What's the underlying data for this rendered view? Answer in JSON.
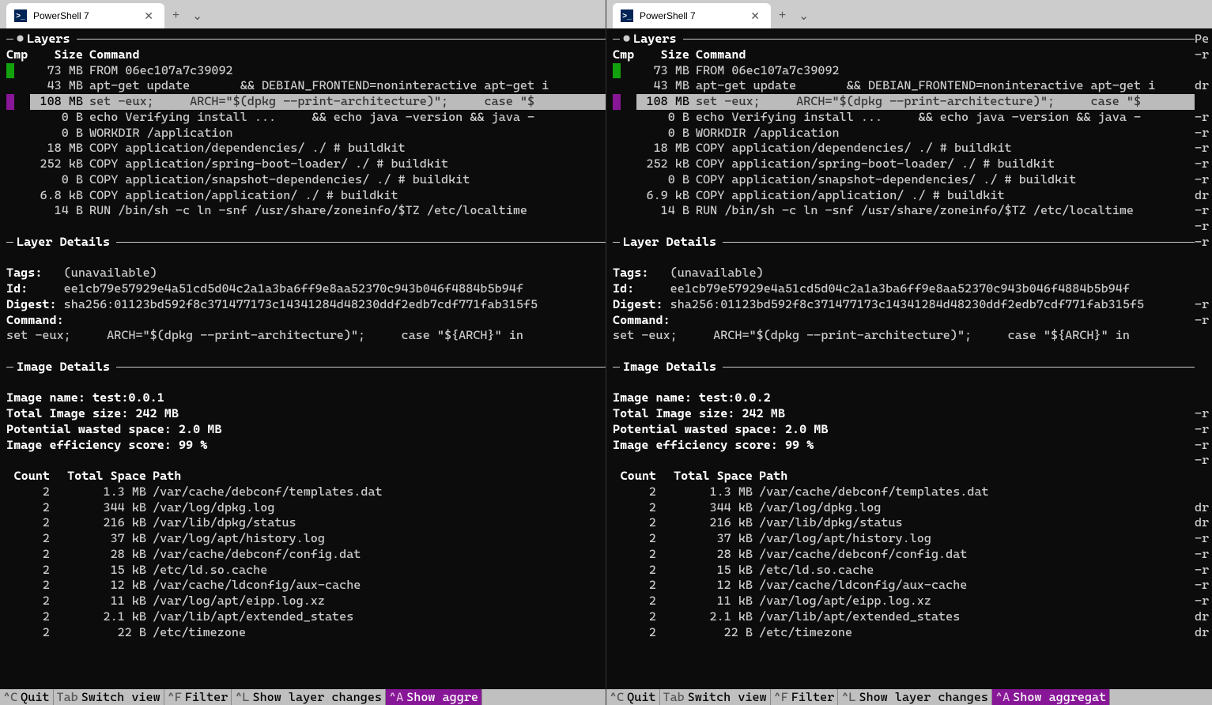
{
  "panes": [
    {
      "tab_title": "PowerShell 7",
      "layers_title": "Layers",
      "layers_header": {
        "cmp": "Cmp",
        "size": "Size",
        "command": "Command"
      },
      "layers": [
        {
          "cmp": "green",
          "size": "73 MB",
          "command": "FROM 06ec107a7c39092",
          "selected": false
        },
        {
          "cmp": "",
          "size": "43 MB",
          "command": "apt-get update       && DEBIAN_FRONTEND=noninteractive apt-get i",
          "selected": false
        },
        {
          "cmp": "purple",
          "size": "108 MB",
          "command": "set -eux;     ARCH=\"$(dpkg --print-architecture)\";     case \"$",
          "selected": true
        },
        {
          "cmp": "",
          "size": "0 B",
          "command": "echo Verifying install ...     && echo java -version && java -",
          "selected": false
        },
        {
          "cmp": "",
          "size": "0 B",
          "command": "WORKDIR /application",
          "selected": false
        },
        {
          "cmp": "",
          "size": "18 MB",
          "command": "COPY application/dependencies/ ./ # buildkit",
          "selected": false
        },
        {
          "cmp": "",
          "size": "252 kB",
          "command": "COPY application/spring-boot-loader/ ./ # buildkit",
          "selected": false
        },
        {
          "cmp": "",
          "size": "0 B",
          "command": "COPY application/snapshot-dependencies/ ./ # buildkit",
          "selected": false
        },
        {
          "cmp": "",
          "size": "6.8 kB",
          "command": "COPY application/application/ ./ # buildkit",
          "selected": false
        },
        {
          "cmp": "",
          "size": "14 B",
          "command": "RUN /bin/sh -c ln -snf /usr/share/zoneinfo/$TZ /etc/localtime",
          "selected": false
        }
      ],
      "layer_details_title": "Layer Details",
      "layer_details": {
        "tags_label": "Tags:",
        "tags": "(unavailable)",
        "id_label": "Id:",
        "id": "ee1cb79e57929e4a51cd5d04c2a1a3ba6ff9e8aa52370c943b046f4884b5b94f",
        "digest_label": "Digest:",
        "digest": "sha256:01123bd592f8c371477173c14341284d48230ddf2edb7cdf771fab315f5",
        "command_label": "Command:",
        "command": "set -eux;     ARCH=\"$(dpkg --print-architecture)\";     case \"${ARCH}\" in"
      },
      "image_details_title": "Image Details",
      "image_details": {
        "name_label": "Image name:",
        "name": "test:0.0.1",
        "size_label": "Total Image size:",
        "size": "242 MB",
        "wasted_label": "Potential wasted space:",
        "wasted": "2.0 MB",
        "efficiency_label": "Image efficiency score:",
        "efficiency": "99 %"
      },
      "wasted_header": {
        "count": "Count",
        "space": "Total Space",
        "path": "Path"
      },
      "wasted": [
        {
          "count": "2",
          "space": "1.3 MB",
          "path": "/var/cache/debconf/templates.dat"
        },
        {
          "count": "2",
          "space": "344 kB",
          "path": "/var/log/dpkg.log"
        },
        {
          "count": "2",
          "space": "216 kB",
          "path": "/var/lib/dpkg/status"
        },
        {
          "count": "2",
          "space": "37 kB",
          "path": "/var/log/apt/history.log"
        },
        {
          "count": "2",
          "space": "28 kB",
          "path": "/var/cache/debconf/config.dat"
        },
        {
          "count": "2",
          "space": "15 kB",
          "path": "/etc/ld.so.cache"
        },
        {
          "count": "2",
          "space": "12 kB",
          "path": "/var/cache/ldconfig/aux-cache"
        },
        {
          "count": "2",
          "space": "11 kB",
          "path": "/var/log/apt/eipp.log.xz"
        },
        {
          "count": "2",
          "space": "2.1 kB",
          "path": "/var/lib/apt/extended_states"
        },
        {
          "count": "2",
          "space": "22 B",
          "path": "/etc/timezone"
        }
      ],
      "footer": [
        {
          "key": "^C",
          "label": "Quit",
          "active": false
        },
        {
          "key": "Tab",
          "label": "Switch view",
          "active": false
        },
        {
          "key": "^F",
          "label": "Filter",
          "active": false
        },
        {
          "key": "^L",
          "label": "Show layer changes",
          "active": false
        },
        {
          "key": "^A",
          "label": "Show aggre",
          "active": true
        }
      ],
      "right_edge": []
    },
    {
      "tab_title": "PowerShell 7",
      "layers_title": "Layers",
      "layers_header": {
        "cmp": "Cmp",
        "size": "Size",
        "command": "Command"
      },
      "layers": [
        {
          "cmp": "green",
          "size": "73 MB",
          "command": "FROM 06ec107a7c39092",
          "selected": false
        },
        {
          "cmp": "",
          "size": "43 MB",
          "command": "apt-get update       && DEBIAN_FRONTEND=noninteractive apt-get i",
          "selected": false
        },
        {
          "cmp": "purple",
          "size": "108 MB",
          "command": "set -eux;     ARCH=\"$(dpkg --print-architecture)\";     case \"$",
          "selected": true
        },
        {
          "cmp": "",
          "size": "0 B",
          "command": "echo Verifying install ...     && echo java -version && java -",
          "selected": false
        },
        {
          "cmp": "",
          "size": "0 B",
          "command": "WORKDIR /application",
          "selected": false
        },
        {
          "cmp": "",
          "size": "18 MB",
          "command": "COPY application/dependencies/ ./ # buildkit",
          "selected": false
        },
        {
          "cmp": "",
          "size": "252 kB",
          "command": "COPY application/spring-boot-loader/ ./ # buildkit",
          "selected": false
        },
        {
          "cmp": "",
          "size": "0 B",
          "command": "COPY application/snapshot-dependencies/ ./ # buildkit",
          "selected": false
        },
        {
          "cmp": "",
          "size": "6.9 kB",
          "command": "COPY application/application/ ./ # buildkit",
          "selected": false
        },
        {
          "cmp": "",
          "size": "14 B",
          "command": "RUN /bin/sh -c ln -snf /usr/share/zoneinfo/$TZ /etc/localtime",
          "selected": false
        }
      ],
      "layer_details_title": "Layer Details",
      "layer_details": {
        "tags_label": "Tags:",
        "tags": "(unavailable)",
        "id_label": "Id:",
        "id": "ee1cb79e57929e4a51cd5d04c2a1a3ba6ff9e8aa52370c943b046f4884b5b94f",
        "digest_label": "Digest:",
        "digest": "sha256:01123bd592f8c371477173c14341284d48230ddf2edb7cdf771fab315f5",
        "command_label": "Command:",
        "command": "set -eux;     ARCH=\"$(dpkg --print-architecture)\";     case \"${ARCH}\" in"
      },
      "image_details_title": "Image Details",
      "image_details": {
        "name_label": "Image name:",
        "name": "test:0.0.2",
        "size_label": "Total Image size:",
        "size": "242 MB",
        "wasted_label": "Potential wasted space:",
        "wasted": "2.0 MB",
        "efficiency_label": "Image efficiency score:",
        "efficiency": "99 %"
      },
      "wasted_header": {
        "count": "Count",
        "space": "Total Space",
        "path": "Path"
      },
      "wasted": [
        {
          "count": "2",
          "space": "1.3 MB",
          "path": "/var/cache/debconf/templates.dat"
        },
        {
          "count": "2",
          "space": "344 kB",
          "path": "/var/log/dpkg.log"
        },
        {
          "count": "2",
          "space": "216 kB",
          "path": "/var/lib/dpkg/status"
        },
        {
          "count": "2",
          "space": "37 kB",
          "path": "/var/log/apt/history.log"
        },
        {
          "count": "2",
          "space": "28 kB",
          "path": "/var/cache/debconf/config.dat"
        },
        {
          "count": "2",
          "space": "15 kB",
          "path": "/etc/ld.so.cache"
        },
        {
          "count": "2",
          "space": "12 kB",
          "path": "/var/cache/ldconfig/aux-cache"
        },
        {
          "count": "2",
          "space": "11 kB",
          "path": "/var/log/apt/eipp.log.xz"
        },
        {
          "count": "2",
          "space": "2.1 kB",
          "path": "/var/lib/apt/extended_states"
        },
        {
          "count": "2",
          "space": "22 B",
          "path": "/etc/timezone"
        }
      ],
      "footer": [
        {
          "key": "^C",
          "label": "Quit",
          "active": false
        },
        {
          "key": "Tab",
          "label": "Switch view",
          "active": false
        },
        {
          "key": "^F",
          "label": "Filter",
          "active": false
        },
        {
          "key": "^L",
          "label": "Show layer changes",
          "active": false
        },
        {
          "key": "^A",
          "label": "Show aggregat",
          "active": true
        }
      ],
      "right_edge": [
        "Pe",
        "-r",
        "",
        "dr",
        "",
        "-r",
        "-r",
        "-r",
        "-r",
        "-r",
        "dr",
        "-r",
        "-r",
        "-r",
        "",
        "",
        "",
        "-r",
        "-r",
        "",
        "",
        "",
        "",
        "",
        "-r",
        "-r",
        "-r",
        "-r",
        "",
        "",
        "dr",
        "dr",
        "-r",
        "-r",
        "-r",
        "-r",
        "-r",
        "dr",
        "dr",
        ""
      ]
    }
  ]
}
